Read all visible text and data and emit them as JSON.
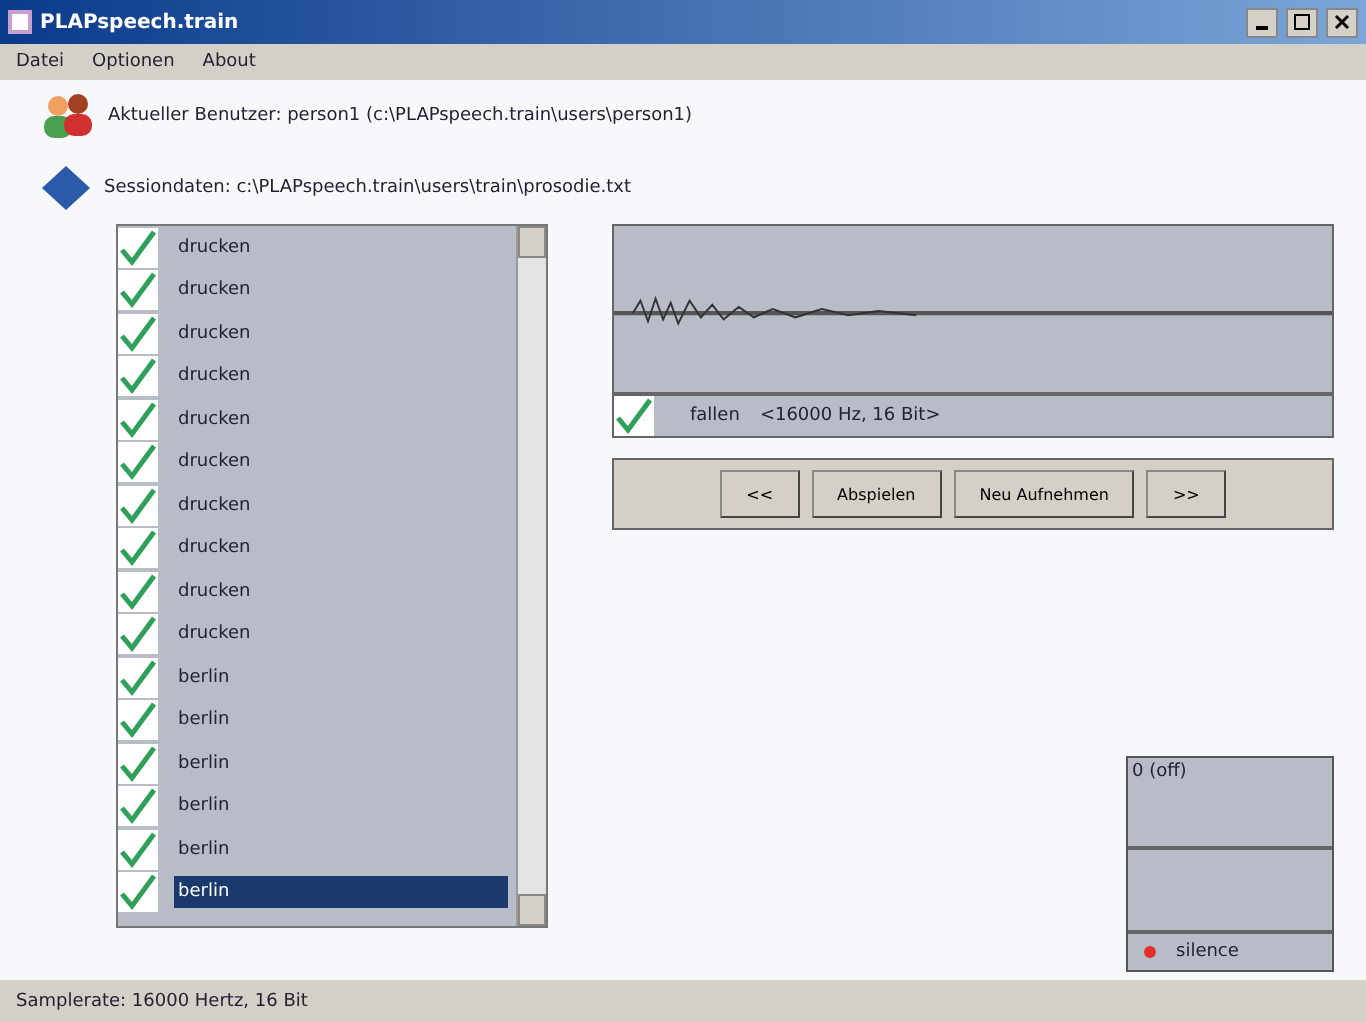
{
  "window": {
    "title": "PLAPspeech.train"
  },
  "menu": [
    "Datei",
    "Optionen",
    "About"
  ],
  "user_line": "Aktueller Benutzer: person1 (c:\\PLAPspeech.train\\users\\person1)",
  "session_line": "Sessiondaten: c:\\PLAPspeech.train\\users\\train\\prosodie.txt",
  "items": [
    {
      "label": "drucken",
      "checked": true,
      "selected": false
    },
    {
      "label": "drucken",
      "checked": true,
      "selected": false
    },
    {
      "label": "drucken",
      "checked": true,
      "selected": false
    },
    {
      "label": "drucken",
      "checked": true,
      "selected": false
    },
    {
      "label": "drucken",
      "checked": true,
      "selected": false
    },
    {
      "label": "drucken",
      "checked": true,
      "selected": false
    },
    {
      "label": "drucken",
      "checked": true,
      "selected": false
    },
    {
      "label": "drucken",
      "checked": true,
      "selected": false
    },
    {
      "label": "drucken",
      "checked": true,
      "selected": false
    },
    {
      "label": "drucken",
      "checked": true,
      "selected": false
    },
    {
      "label": "berlin",
      "checked": true,
      "selected": false
    },
    {
      "label": "berlin",
      "checked": true,
      "selected": false
    },
    {
      "label": "berlin",
      "checked": true,
      "selected": false
    },
    {
      "label": "berlin",
      "checked": true,
      "selected": false
    },
    {
      "label": "berlin",
      "checked": true,
      "selected": false
    },
    {
      "label": "berlin",
      "checked": true,
      "selected": true
    }
  ],
  "recording": {
    "checked": true,
    "word": "fallen",
    "format": "<16000 Hz, 16 Bit>"
  },
  "buttons": [
    "<<",
    "Abspielen",
    "Neu Aufnehmen",
    ">>"
  ],
  "level_box": {
    "label": "0 (off)",
    "status": "silence",
    "color": "#e03030"
  },
  "status_bar": "Samplerate: 16000 Hertz, 16 Bit"
}
